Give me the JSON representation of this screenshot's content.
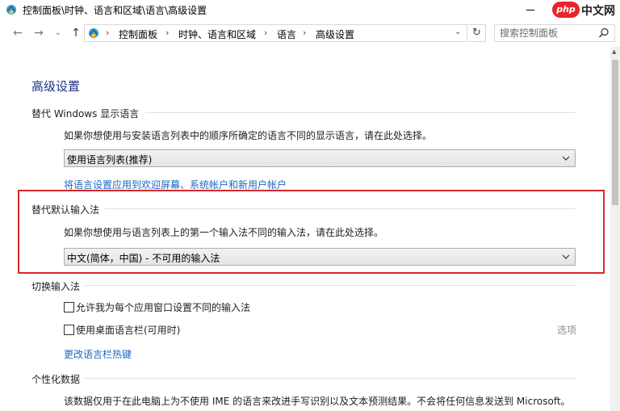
{
  "window": {
    "title": "控制面板\\时钟、语言和区域\\语言\\高级设置",
    "minimize_label": "—"
  },
  "brand": {
    "badge": "php",
    "text": "中文网"
  },
  "nav": {
    "back_glyph": "←",
    "forward_glyph": "→",
    "recent_glyph": "⌄",
    "up_glyph": "↑",
    "breadcrumbs": [
      "控制面板",
      "时钟、语言和区域",
      "语言",
      "高级设置"
    ],
    "separator": "›",
    "dropdown_glyph": "⌄",
    "refresh_glyph": "↻",
    "search_placeholder": "搜索控制面板"
  },
  "page": {
    "title": "高级设置",
    "sections": {
      "display_language": {
        "header": "替代 Windows 显示语言",
        "description": "如果你想使用与安装语言列表中的顺序所确定的语言不同的显示语言，请在此处选择。",
        "select_value": "使用语言列表(推荐)",
        "link": "将语言设置应用到欢迎屏幕、系统帐户和新用户帐户"
      },
      "default_input": {
        "header": "替代默认输入法",
        "description": "如果你想使用与语言列表上的第一个输入法不同的输入法，请在此处选择。",
        "select_value": "中文(简体，中国) - 不可用的输入法"
      },
      "switch_input": {
        "header": "切换输入法",
        "checkbox_per_app": "允许我为每个应用窗口设置不同的输入法",
        "checkbox_language_bar": "使用桌面语言栏(可用时)",
        "options_link": "选项",
        "hotkeys_link": "更改语言栏热键"
      },
      "personalization": {
        "header": "个性化数据",
        "description": "该数据仅用于在此电脑上为不使用 IME 的语言来改进手写识别以及文本预测结果。不会将任何信息发送到 Microsoft。"
      }
    }
  },
  "colors": {
    "title_blue": "#1e3287",
    "link_blue": "#1a66c2",
    "highlight_red": "#d6282b"
  }
}
